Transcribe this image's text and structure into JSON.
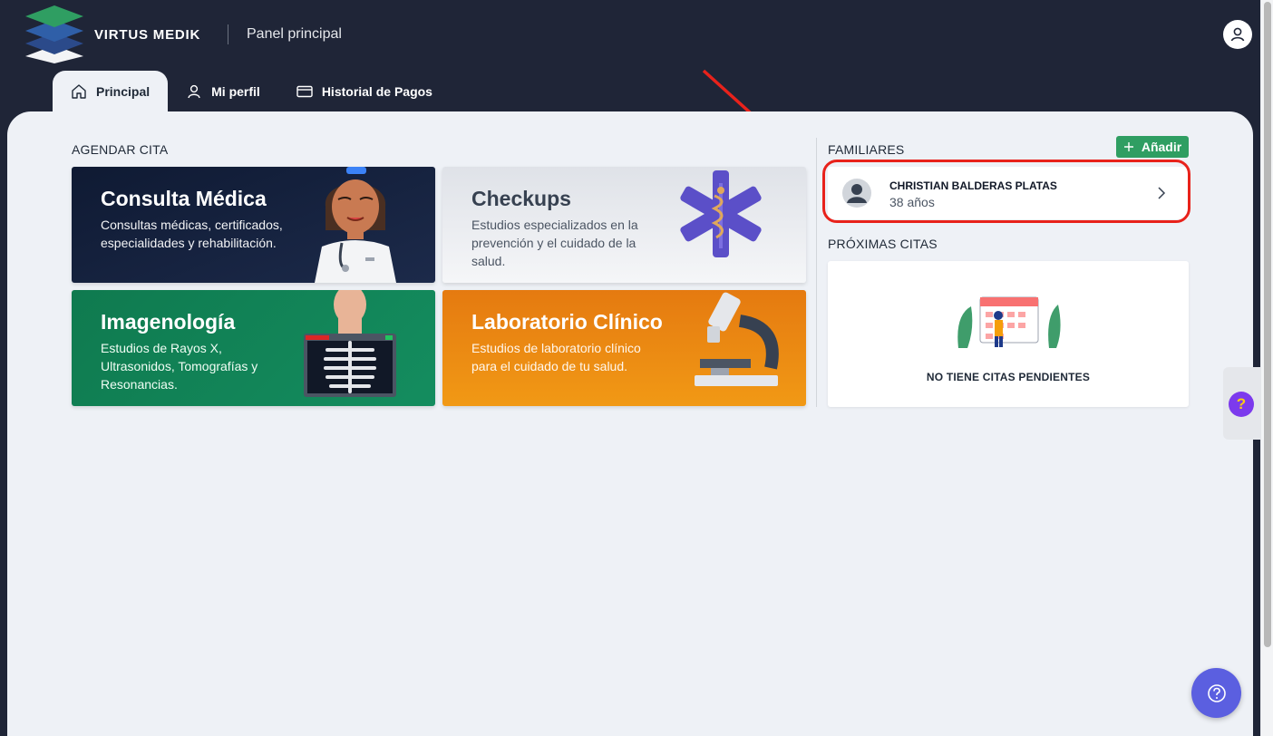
{
  "header": {
    "brand": "VIRTUS MEDIK",
    "page_title": "Panel principal"
  },
  "tabs": [
    {
      "label": "Principal",
      "icon": "home-icon",
      "active": true
    },
    {
      "label": "Mi perfil",
      "icon": "user-icon",
      "active": false
    },
    {
      "label": "Historial de Pagos",
      "icon": "credit-card-icon",
      "active": false
    }
  ],
  "agendar": {
    "label": "AGENDAR CITA",
    "cards": [
      {
        "title": "Consulta Médica",
        "description": "Consultas médicas, certificados, especialidades y rehabilitación.",
        "color": "#16213a"
      },
      {
        "title": "Checkups",
        "description": "Estudios especializados en la prevención y el cuidado de la salud.",
        "color": "#e7e9ee"
      },
      {
        "title": "Imagenología",
        "description": "Estudios de Rayos X, Ultrasonidos, Tomografías y Resonancias.",
        "color": "#138659"
      },
      {
        "title": "Laboratorio Clínico",
        "description": "Estudios de laboratorio clínico para el cuidado de tu salud.",
        "color": "#ee8a12"
      }
    ]
  },
  "familiares": {
    "label": "FAMILIARES",
    "add_label": "Añadir",
    "members": [
      {
        "name": "CHRISTIAN BALDERAS PLATAS",
        "age": "38 años"
      }
    ]
  },
  "proximas": {
    "label": "PRÓXIMAS CITAS",
    "empty_text": "NO TIENE CITAS PENDIENTES"
  },
  "colors": {
    "header_bg": "#1f2537",
    "content_bg": "#eef1f6",
    "accent_green": "#2f9e62",
    "highlight_red": "#e8221b",
    "fab_blue": "#5b5fe0"
  }
}
